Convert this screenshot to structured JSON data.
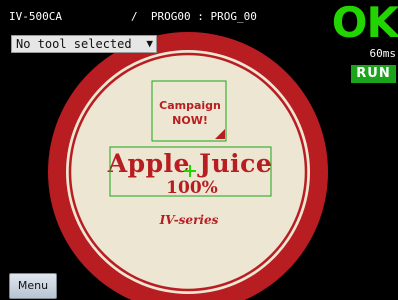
{
  "header": {
    "device_name": "IV-500CA",
    "program": "/  PROG00 : PROG_00"
  },
  "tool_select": {
    "selected": "No tool selected",
    "arrow_icon": "triangle-down-icon"
  },
  "result": {
    "status": "OK",
    "time": "60ms",
    "mode": "RUN",
    "status_color": "#22d400",
    "mode_color": "#1aa51a"
  },
  "label": {
    "campaign_line1": "Campaign",
    "campaign_line2": "NOW!",
    "product_name": "Apple Juice",
    "product_percent": "100%",
    "series": "IV-series",
    "label_red": "#b81d22",
    "label_cream": "#ece6d2",
    "roi_color": "#1aa51a"
  },
  "footer": {
    "menu_label": "Menu"
  }
}
